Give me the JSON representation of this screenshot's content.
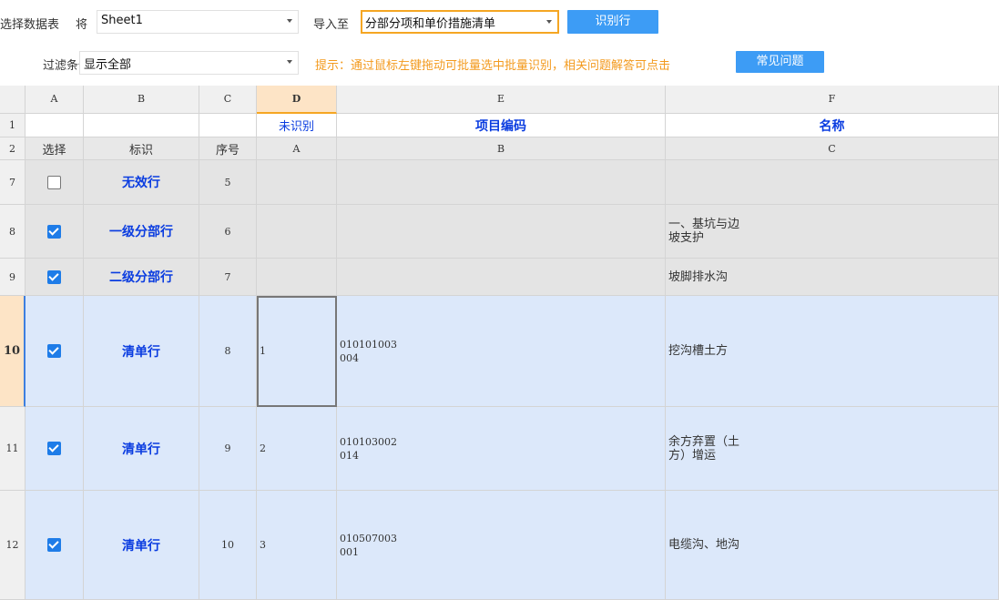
{
  "toolbar": {
    "select_table_label": "选择数据表",
    "to_label": "将",
    "sheet_value": "Sheet1",
    "import_to_label": "导入至",
    "import_target_value": "分部分项和单价措施清单",
    "identify_button": "识别行",
    "filter_label": "过滤条件",
    "filter_value": "显示全部",
    "hint_text": "提示：通过鼠标左键拖动可批量选中批量识别，相关问题解答可点击",
    "faq_button": "常见问题"
  },
  "columns": [
    "A",
    "B",
    "C",
    "D",
    "E",
    "F"
  ],
  "header_rows": {
    "row1": {
      "num": "1",
      "D": "未识别",
      "E": "项目编码",
      "F": "名称"
    },
    "row2": {
      "num": "2",
      "A": "选择",
      "B": "标识",
      "C": "序号",
      "D": "A",
      "E": "B",
      "F": "C"
    }
  },
  "rows": [
    {
      "num": "7",
      "checked": false,
      "type": "无效行",
      "seq": "5",
      "D": "",
      "code": "",
      "name": ""
    },
    {
      "num": "8",
      "checked": true,
      "type": "一级分部行",
      "seq": "6",
      "D": "",
      "code": "",
      "name": "一、基坑与边\n坡支护"
    },
    {
      "num": "9",
      "checked": true,
      "type": "二级分部行",
      "seq": "7",
      "D": "",
      "code": "",
      "name": "坡脚排水沟"
    },
    {
      "num": "10",
      "checked": true,
      "type": "清单行",
      "seq": "8",
      "D": "1",
      "code": "010101003\n004",
      "name": "挖沟槽土方"
    },
    {
      "num": "11",
      "checked": true,
      "type": "清单行",
      "seq": "9",
      "D": "2",
      "code": "010103002\n014",
      "name": "余方弃置（土\n方）增运"
    },
    {
      "num": "12",
      "checked": true,
      "type": "清单行",
      "seq": "10",
      "D": "3",
      "code": "010507003\n001",
      "name": "电缆沟、地沟"
    }
  ],
  "colors": {
    "accent_blue": "#3d9cf5",
    "hint_orange": "#f39a1e",
    "identified_text": "#0a3ce0",
    "row_grey": "#e4e4e4",
    "row_blue": "#dce8fa"
  }
}
